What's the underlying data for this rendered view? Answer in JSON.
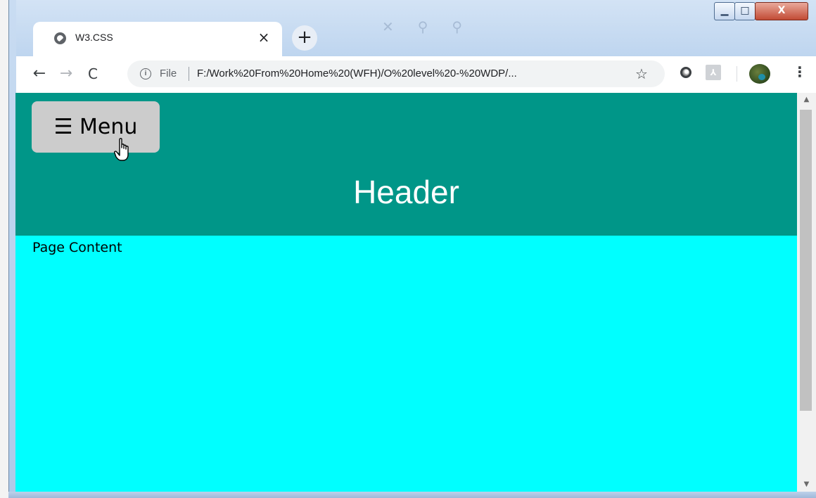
{
  "browser": {
    "tab_title": "W3.CSS",
    "tab_close": "×",
    "new_tab": "+",
    "omnibox_label": "File",
    "url": "F:/Work%20From%20Home%20(WFH)/O%20level%20-%20WDP/...",
    "info_icon": "i",
    "back_icon": "←",
    "forward_icon": "→",
    "reload_icon": "C",
    "star_icon": "☆",
    "menu_icon": "⋮",
    "window_min": "▁",
    "window_max": "□",
    "window_close": "X"
  },
  "page": {
    "menu_button": "☰ Menu",
    "header_title": "Header",
    "content_text": "Page Content",
    "colors": {
      "header_bg": "#009688",
      "content_bg": "#00ffff",
      "menu_button_bg": "#cccccc",
      "header_text": "#ffffff"
    }
  },
  "icons": {
    "tab_favicon": "globe-icon",
    "pdf_extension": "pdf-icon",
    "extension": "circle-extension-icon",
    "profile": "avatar"
  }
}
